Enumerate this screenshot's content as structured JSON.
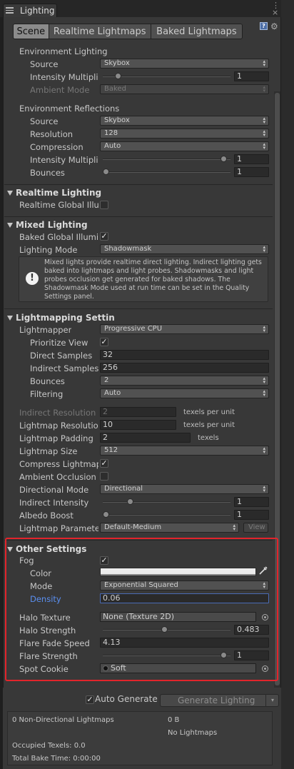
{
  "window": {
    "tab_title": "Lighting"
  },
  "toolbar": {
    "tabs": [
      "Scene",
      "Realtime Lightmaps",
      "Baked Lightmaps"
    ],
    "active_tab": "Scene"
  },
  "environment_lighting": {
    "header": "Environment Lighting",
    "source_label": "Source",
    "source_value": "Skybox",
    "intensity_label": "Intensity Multiplie",
    "intensity_value": "1",
    "ambient_mode_label": "Ambient Mode",
    "ambient_mode_value": "Baked"
  },
  "environment_reflections": {
    "header": "Environment Reflections",
    "source_label": "Source",
    "source_value": "Skybox",
    "resolution_label": "Resolution",
    "resolution_value": "128",
    "compression_label": "Compression",
    "compression_value": "Auto",
    "intensity_label": "Intensity Multiplie",
    "intensity_value": "1",
    "bounces_label": "Bounces",
    "bounces_value": "1"
  },
  "realtime_lighting": {
    "header": "Realtime Lighting",
    "gi_label": "Realtime Global Illu"
  },
  "mixed_lighting": {
    "header": "Mixed Lighting",
    "baked_gi_label": "Baked Global Illumi",
    "lighting_mode_label": "Lighting Mode",
    "lighting_mode_value": "Shadowmask",
    "info_text": "Mixed lights provide realtime direct lighting. Indirect lighting gets baked into lightmaps and light probes. Shadowmasks and light probes occlusion get generated for baked shadows. The Shadowmask Mode used at run time can be set in the Quality Settings panel."
  },
  "lightmapping": {
    "header": "Lightmapping Settin",
    "lightmapper_label": "Lightmapper",
    "lightmapper_value": "Progressive CPU",
    "prioritize_label": "Prioritize View",
    "direct_samples_label": "Direct Samples",
    "direct_samples_value": "32",
    "indirect_samples_label": "Indirect Samples",
    "indirect_samples_value": "256",
    "bounces_label": "Bounces",
    "bounces_value": "2",
    "filtering_label": "Filtering",
    "filtering_value": "Auto",
    "indirect_res_label": "Indirect Resolution",
    "indirect_res_value": "2",
    "indirect_res_unit": "texels per unit",
    "lightmap_res_label": "Lightmap Resolutio",
    "lightmap_res_value": "10",
    "lightmap_res_unit": "texels per unit",
    "padding_label": "Lightmap Padding",
    "padding_value": "2",
    "padding_unit": "texels",
    "size_label": "Lightmap Size",
    "size_value": "512",
    "compress_label": "Compress Lightmap",
    "ao_label": "Ambient Occlusion",
    "directional_label": "Directional Mode",
    "directional_value": "Directional",
    "indirect_intensity_label": "Indirect Intensity",
    "indirect_intensity_value": "1",
    "albedo_label": "Albedo Boost",
    "albedo_value": "1",
    "params_label": "Lightmap Paramete",
    "params_value": "Default-Medium",
    "view_label": "View"
  },
  "other_settings": {
    "header": "Other Settings",
    "fog_label": "Fog",
    "color_label": "Color",
    "mode_label": "Mode",
    "mode_value": "Exponential Squared",
    "density_label": "Density",
    "density_value": "0.06",
    "halo_texture_label": "Halo Texture",
    "halo_texture_value": "None (Texture 2D)",
    "halo_strength_label": "Halo Strength",
    "halo_strength_value": "0.483",
    "flare_fade_label": "Flare Fade Speed",
    "flare_fade_value": "4.13",
    "flare_strength_label": "Flare Strength",
    "flare_strength_value": "1",
    "spot_cookie_label": "Spot Cookie",
    "spot_cookie_value": "Soft"
  },
  "footer": {
    "auto_generate_label": "Auto Generate",
    "generate_label": "Generate Lighting",
    "stats": {
      "non_directional": "0 Non-Directional Lightmaps",
      "size": "0 B",
      "no_lightmaps": "No Lightmaps",
      "occupied": "Occupied Texels: 0.0",
      "bake_time": "Total Bake Time: 0:00:00"
    }
  },
  "colors": {
    "panel": "#383838",
    "highlight_border": "#e2242b",
    "density_label": "#5a8ff0",
    "fog_color": "#ededed"
  },
  "slider_levels": {
    "env_intensity": 0.1,
    "refl_intensity": 0.97,
    "refl_bounces": 0.0,
    "indirect_intensity": 0.2,
    "albedo_boost": 0.0,
    "halo_strength": 0.48,
    "flare_strength": 0.97
  }
}
